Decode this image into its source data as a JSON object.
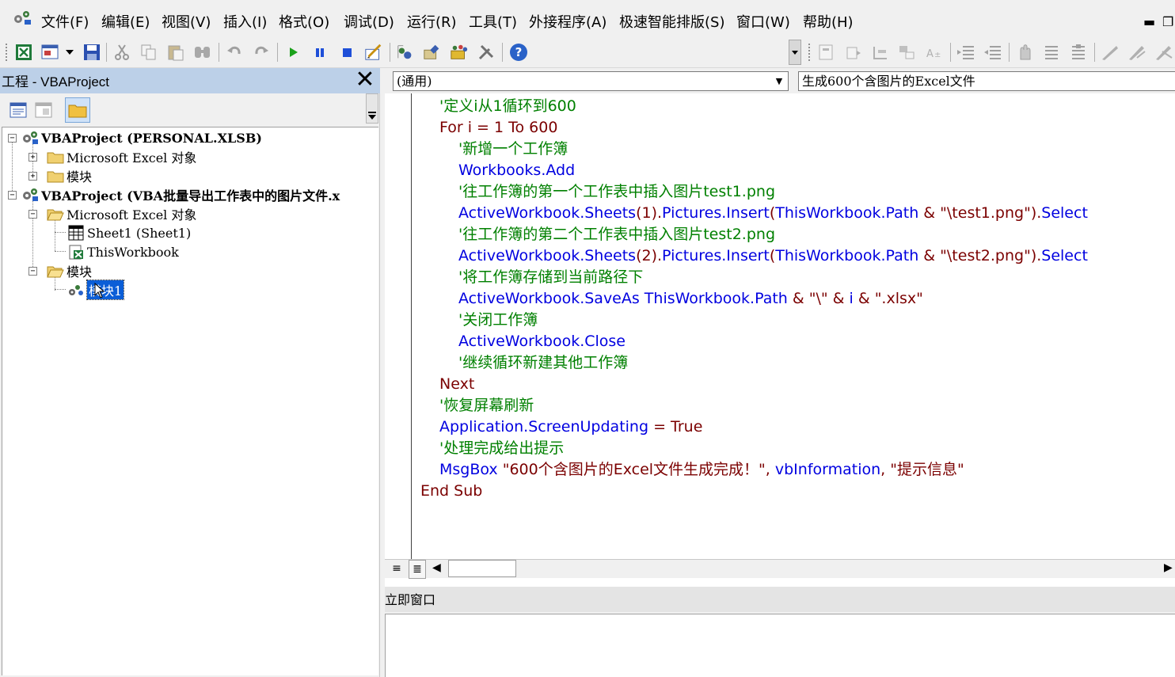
{
  "menubar": {
    "items": [
      "文件(F)",
      "编辑(E)",
      "视图(V)",
      "插入(I)",
      "格式(O)",
      "调试(D)",
      "运行(R)",
      "工具(T)",
      "外接程序(A)",
      "极速智能排版(S)",
      "窗口(W)",
      "帮助(H)"
    ],
    "minimize_glyph": "▬",
    "restore_glyph": "❐"
  },
  "toolbar": {
    "icons": [
      "excel-view-icon",
      "insert-module-icon",
      "save-icon",
      "cut-icon",
      "copy-icon",
      "paste-icon",
      "find-icon",
      "undo-icon",
      "redo-icon",
      "run-icon",
      "break-icon",
      "reset-icon",
      "design-mode-icon",
      "project-explorer-icon",
      "properties-icon",
      "object-browser-icon",
      "toolbox-icon",
      "help-icon"
    ],
    "run_color": "#1aa11a",
    "pause_color": "#1e4fd8",
    "help_glyph": "?"
  },
  "project": {
    "title": "工程 - VBAProject",
    "close_glyph": "✕",
    "tree": [
      {
        "label": "VBAProject (PERSONAL.XLSB)",
        "level": 0,
        "bold": true,
        "expander": "−"
      },
      {
        "label": "Microsoft Excel 对象",
        "level": 1,
        "expander": "+"
      },
      {
        "label": "模块",
        "level": 1,
        "expander": "+"
      },
      {
        "label": "VBAProject (VBA批量导出工作表中的图片文件.x",
        "level": 0,
        "bold": true,
        "expander": "−"
      },
      {
        "label": "Microsoft Excel 对象",
        "level": 1,
        "expander": "−"
      },
      {
        "label": "Sheet1 (Sheet1)",
        "level": 2
      },
      {
        "label": "ThisWorkbook",
        "level": 2
      },
      {
        "label": "模块",
        "level": 1,
        "expander": "−"
      },
      {
        "label": "模块1",
        "level": 2,
        "selected": true
      }
    ]
  },
  "code": {
    "object_combo": "(通用)",
    "proc_combo": "生成600个含图片的Excel文件",
    "combo_arrow": "▼",
    "lines": [
      {
        "indent": 1,
        "parts": [
          {
            "t": "'定义i从1循环到600",
            "c": "cm"
          }
        ]
      },
      {
        "indent": 1,
        "parts": [
          {
            "t": "For i = 1 To 600",
            "c": "kw"
          }
        ]
      },
      {
        "indent": 2,
        "parts": [
          {
            "t": "'新增一个工作簿",
            "c": "cm"
          }
        ]
      },
      {
        "indent": 2,
        "parts": [
          {
            "t": "Workbooks.Add",
            "c": "bl"
          }
        ]
      },
      {
        "indent": 2,
        "parts": [
          {
            "t": "'往工作簿的第一个工作表中插入图片test1.png",
            "c": "cm"
          }
        ]
      },
      {
        "indent": 2,
        "parts": [
          {
            "t": "ActiveWorkbook.Sheets",
            "c": "bl"
          },
          {
            "t": "(1).",
            "c": "tx"
          },
          {
            "t": "Pictures.Insert",
            "c": "bl"
          },
          {
            "t": "(",
            "c": "tx"
          },
          {
            "t": "ThisWorkbook.Path",
            "c": "bl"
          },
          {
            "t": " & \"\\test1.png\").",
            "c": "tx"
          },
          {
            "t": "Select",
            "c": "bl"
          }
        ]
      },
      {
        "indent": 2,
        "parts": [
          {
            "t": "'往工作簿的第二个工作表中插入图片test2.png",
            "c": "cm"
          }
        ]
      },
      {
        "indent": 2,
        "parts": [
          {
            "t": "ActiveWorkbook.Sheets",
            "c": "bl"
          },
          {
            "t": "(2).",
            "c": "tx"
          },
          {
            "t": "Pictures.Insert",
            "c": "bl"
          },
          {
            "t": "(",
            "c": "tx"
          },
          {
            "t": "ThisWorkbook.Path",
            "c": "bl"
          },
          {
            "t": " & \"\\test2.png\").",
            "c": "tx"
          },
          {
            "t": "Select",
            "c": "bl"
          }
        ]
      },
      {
        "indent": 2,
        "parts": [
          {
            "t": "'将工作簿存储到当前路径下",
            "c": "cm"
          }
        ]
      },
      {
        "indent": 2,
        "parts": [
          {
            "t": "ActiveWorkbook.SaveAs ThisWorkbook.Path",
            "c": "bl"
          },
          {
            "t": " & \"\\\" & ",
            "c": "tx"
          },
          {
            "t": "i",
            "c": "bl"
          },
          {
            "t": " & \".xlsx\"",
            "c": "tx"
          }
        ]
      },
      {
        "indent": 2,
        "parts": [
          {
            "t": "'关闭工作簿",
            "c": "cm"
          }
        ]
      },
      {
        "indent": 2,
        "parts": [
          {
            "t": "ActiveWorkbook.Close",
            "c": "bl"
          }
        ]
      },
      {
        "indent": 2,
        "parts": [
          {
            "t": "'继续循环新建其他工作簿",
            "c": "cm"
          }
        ]
      },
      {
        "indent": 1,
        "parts": [
          {
            "t": "Next",
            "c": "kw"
          }
        ]
      },
      {
        "indent": 1,
        "parts": [
          {
            "t": "'恢复屏幕刷新",
            "c": "cm"
          }
        ]
      },
      {
        "indent": 1,
        "parts": [
          {
            "t": "Application.ScreenUpdating",
            "c": "bl"
          },
          {
            "t": " = ",
            "c": "tx"
          },
          {
            "t": "True",
            "c": "kw"
          }
        ]
      },
      {
        "indent": 1,
        "parts": [
          {
            "t": "'处理完成给出提示",
            "c": "cm"
          }
        ]
      },
      {
        "indent": 1,
        "parts": [
          {
            "t": "MsgBox",
            "c": "bl"
          },
          {
            "t": " \"600个含图片的Excel文件生成完成！\", ",
            "c": "tx"
          },
          {
            "t": "vbInformation",
            "c": "bl"
          },
          {
            "t": ", \"提示信息\"",
            "c": "tx"
          }
        ]
      },
      {
        "indent": 0,
        "parts": [
          {
            "t": "End Sub",
            "c": "kw"
          }
        ]
      }
    ],
    "procedure_view_glyph": "≡",
    "full_module_view_glyph": "≣",
    "scroll_left_glyph": "◀",
    "scroll_right_glyph": "▶"
  },
  "immediate": {
    "title": "立即窗口"
  }
}
